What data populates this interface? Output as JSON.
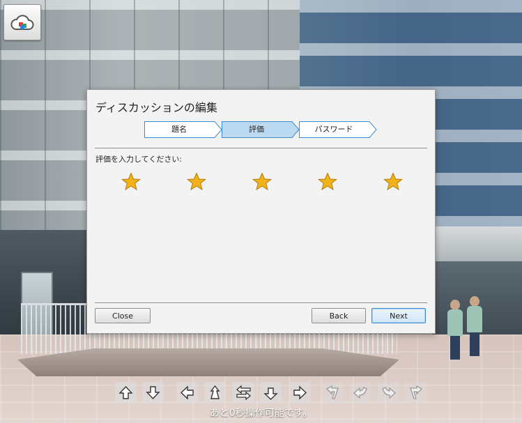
{
  "dialog": {
    "title": "ディスカッションの編集",
    "steps": [
      {
        "label": "題名",
        "active": false
      },
      {
        "label": "評価",
        "active": true
      },
      {
        "label": "パスワード",
        "active": false
      }
    ],
    "prompt": "評価を入力してください:",
    "rating": {
      "max": 5,
      "filled": 5
    },
    "buttons": {
      "close": "Close",
      "back": "Back",
      "next": "Next"
    }
  },
  "navigation": {
    "buttons": [
      {
        "icon": "arrow-up-icon",
        "enabled": true
      },
      {
        "icon": "arrow-down-icon",
        "enabled": true
      },
      {
        "icon": "arrow-left-icon",
        "enabled": true
      },
      {
        "icon": "move-forward-icon",
        "enabled": true
      },
      {
        "icon": "swap-direction-icon",
        "enabled": true
      },
      {
        "icon": "move-back-icon",
        "enabled": true
      },
      {
        "icon": "arrow-right-icon",
        "enabled": true
      },
      {
        "icon": "turn-left-icon",
        "enabled": false
      },
      {
        "icon": "rotate-left-icon",
        "enabled": false
      },
      {
        "icon": "rotate-right-icon",
        "enabled": false
      },
      {
        "icon": "turn-right-icon",
        "enabled": false
      }
    ],
    "status": "あと0秒操作可能です。"
  },
  "colors": {
    "step_active": "#bcd9f2",
    "step_border": "#3b8bd4",
    "star": "#f2b21b",
    "dialog_bg": "#f3f3f3"
  }
}
